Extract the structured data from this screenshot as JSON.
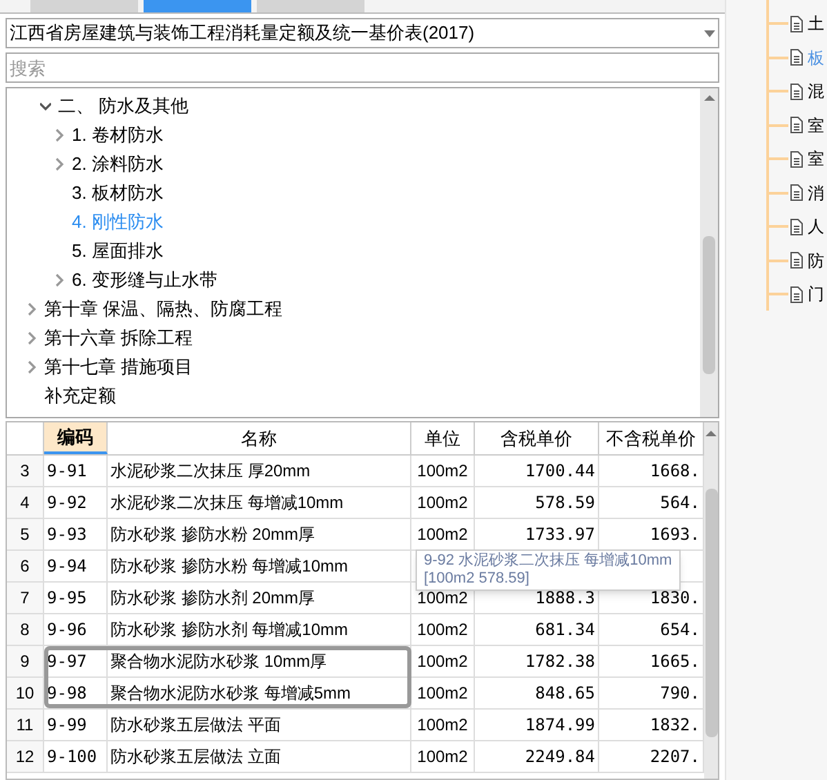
{
  "tabs": [
    {
      "selected": false
    },
    {
      "selected": true
    },
    {
      "selected": false
    }
  ],
  "library": {
    "value": "江西省房屋建筑与装饰工程消耗量定额及统一基价表(2017)"
  },
  "search": {
    "placeholder": "搜索"
  },
  "tree": [
    {
      "children": [
        {
          "label": "二、 防水及其他",
          "kind": "folder",
          "expanded": true,
          "selected": false,
          "children": [
            {
              "label": "1. 卷材防水",
              "kind": "folder",
              "expanded": false,
              "selected": false
            },
            {
              "label": "2. 涂料防水",
              "kind": "folder",
              "expanded": false,
              "selected": false
            },
            {
              "label": "3. 板材防水",
              "kind": "leaf",
              "selected": false
            },
            {
              "label": "4. 刚性防水",
              "kind": "leaf",
              "selected": true
            },
            {
              "label": "5. 屋面排水",
              "kind": "leaf",
              "selected": false
            },
            {
              "label": "6. 变形缝与止水带",
              "kind": "folder",
              "expanded": false,
              "selected": false
            }
          ]
        }
      ]
    },
    {
      "label": "第十章 保温、隔热、防腐工程",
      "kind": "folder",
      "expanded": false,
      "selected": false
    },
    {
      "label": "第十六章 拆除工程",
      "kind": "folder",
      "expanded": false,
      "selected": false
    },
    {
      "label": "第十七章 措施项目",
      "kind": "folder",
      "expanded": false,
      "selected": false
    },
    {
      "label": "补充定额",
      "kind": "leaf",
      "selected": false
    }
  ],
  "table": {
    "columns": [
      {
        "selected": false
      },
      {
        "label": "编码",
        "selected": true
      },
      {
        "label": "名称",
        "selected": false
      },
      {
        "label": "单位",
        "selected": false
      },
      {
        "label": "含税单价",
        "selected": false
      },
      {
        "label": "不含税单价",
        "selected": false
      }
    ],
    "rows": [
      {
        "cells": [
          "3",
          "9-91",
          "水泥砂浆二次抹压 厚20mm",
          "100m2",
          "1700.44",
          "1668."
        ],
        "selected": false
      },
      {
        "cells": [
          "4",
          "9-92",
          "水泥砂浆二次抹压 每增减10mm",
          "100m2",
          "578.59",
          "564."
        ],
        "selected": false
      },
      {
        "cells": [
          "5",
          "9-93",
          "防水砂浆 掺防水粉 20mm厚",
          "100m2",
          "1733.97",
          "1693."
        ],
        "selected": false
      },
      {
        "cells": [
          "6",
          "9-94",
          "防水砂浆 掺防水粉 每增减10mm"
        ],
        "selected": false
      },
      {
        "cells": [
          "7",
          "9-95",
          "防水砂浆 掺防水剂 20mm厚",
          "100m2",
          "1888.3",
          "1830."
        ],
        "selected": false
      },
      {
        "cells": [
          "8",
          "9-96",
          "防水砂浆 掺防水剂 每增减10mm",
          "100m2",
          "681.34",
          "654."
        ],
        "selected": false
      },
      {
        "cells": [
          "9",
          "9-97",
          "聚合物水泥防水砂浆 10mm厚",
          "100m2",
          "1782.38",
          "1665."
        ],
        "selected": true
      },
      {
        "cells": [
          "10",
          "9-98",
          "聚合物水泥防水砂浆 每增减5mm",
          "100m2",
          "848.65",
          "790."
        ],
        "selected": true
      },
      {
        "cells": [
          "11",
          "9-99",
          "防水砂浆五层做法 平面",
          "100m2",
          "1874.99",
          "1832."
        ],
        "selected": false
      },
      {
        "cells": [
          "12",
          "9-100",
          "防水砂浆五层做法 立面",
          "100m2",
          "2249.84",
          "2207."
        ],
        "selected": false
      }
    ]
  },
  "tooltip": {
    "lines": [
      "9-92 水泥砂浆二次抹压 每增减10mm",
      "[100m2 578.59]"
    ]
  },
  "side_tree": [
    {
      "label": "土",
      "selected": false
    },
    {
      "label": "板",
      "selected": true
    },
    {
      "label": "混",
      "selected": false
    },
    {
      "label": "室",
      "selected": false
    },
    {
      "label": "室",
      "selected": false
    },
    {
      "label": "消",
      "selected": false
    },
    {
      "label": "人",
      "selected": false
    },
    {
      "label": "防",
      "selected": false
    },
    {
      "label": "门",
      "selected": false
    }
  ]
}
